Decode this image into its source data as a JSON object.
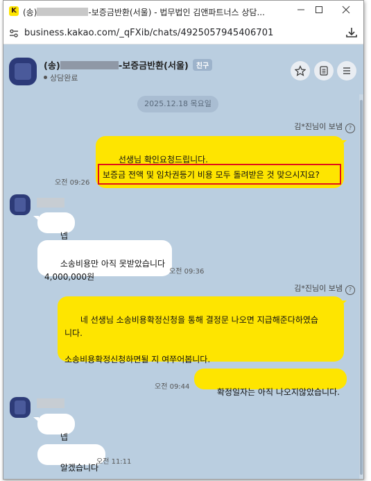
{
  "window": {
    "title_prefix": "(송)",
    "title_suffix": "-보증금반환(서울) - 법무법인 김앤파트너스 상담...",
    "url": "business.kakao.com/_qFXib/chats/4925057945406701",
    "app_icon": "K"
  },
  "chat_header": {
    "name_prefix": "(송)",
    "name_suffix": "-보증금반환(서울)",
    "badge": "친구",
    "status": "상담완료"
  },
  "date_divider": "2025.12.18 목요일",
  "messages": [
    {
      "sender_label": "김*진님이 보냄",
      "text": "선생님 확인요청드립니다.",
      "time": "오전 09:26"
    },
    {
      "text": "보증금 전액 및 임차권등기 비용 모두 돌려받은 것 맞으시지요?"
    },
    {
      "text": "넵"
    },
    {
      "text": "소송비용만 아직 못받았습니다\n4,000,000원",
      "time": "오전 09:36"
    },
    {
      "sender_label": "김*진님이 보냄",
      "text": "네 선생님 소송비용확정신청을 통해 결정문 나오면 지급해준다하였습\n니다.\n\n소송비용확정신청하면될 지 여쭈어봅니다."
    },
    {
      "text": "확정일자는 아직 나오지않았습니다.",
      "time": "오전 09:44"
    },
    {
      "text": "넵"
    },
    {
      "text": "알겠습니다",
      "time": "오전 11:11"
    }
  ],
  "icons": {
    "info": "?",
    "star": "star-icon",
    "list": "list-icon",
    "menu": "menu-icon",
    "download": "download-icon",
    "site": "site-settings-icon"
  },
  "colors": {
    "chat_bg": "#bacee0",
    "my_bubble": "#fee500",
    "highlight": "#e0101a"
  }
}
